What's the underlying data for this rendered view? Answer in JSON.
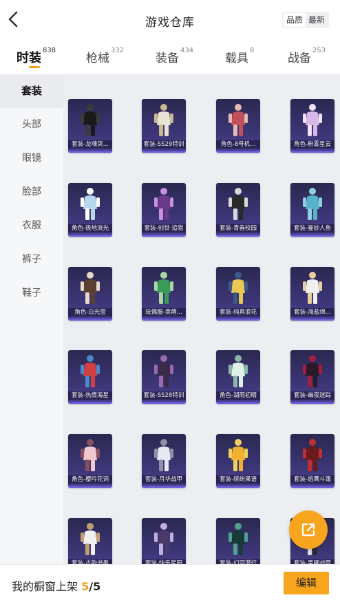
{
  "header": {
    "title": "游戏仓库",
    "sort_options": [
      "品质",
      "最新"
    ],
    "sort_selected": "品质"
  },
  "tabs": [
    {
      "label": "时装",
      "count": "838",
      "active": true
    },
    {
      "label": "枪械",
      "count": "332",
      "active": false
    },
    {
      "label": "装备",
      "count": "434",
      "active": false
    },
    {
      "label": "载具",
      "count": "8",
      "active": false
    },
    {
      "label": "战备",
      "count": "253",
      "active": false
    }
  ],
  "categories": [
    {
      "label": "套装",
      "active": true
    },
    {
      "label": "头部",
      "active": false
    },
    {
      "label": "眼镜",
      "active": false
    },
    {
      "label": "脸部",
      "active": false
    },
    {
      "label": "衣服",
      "active": false
    },
    {
      "label": "裤子",
      "active": false
    },
    {
      "label": "鞋子",
      "active": false
    }
  ],
  "items": [
    {
      "name": "套装-龙魂突..."
    },
    {
      "name": "套装-SS29特训"
    },
    {
      "name": "角色-8号机..."
    },
    {
      "name": "角色-粉雾星云"
    },
    {
      "name": "角色-极地流光"
    },
    {
      "name": "套装-创世·追猎"
    },
    {
      "name": "套装-青春校园"
    },
    {
      "name": "套装-曼妙人鱼"
    },
    {
      "name": "角色-白光莹"
    },
    {
      "name": "玩偶服-卖萌..."
    },
    {
      "name": "套装-纯真浪花"
    },
    {
      "name": "套装-海盐绵..."
    },
    {
      "name": "套装-热情海星"
    },
    {
      "name": "套装-SS28特训"
    },
    {
      "name": "角色-湖雨初晴"
    },
    {
      "name": "套装-幽夜迷踪"
    },
    {
      "name": "角色-樱吟花词"
    },
    {
      "name": "套装-月华战甲"
    },
    {
      "name": "套装-缤纷果语"
    },
    {
      "name": "套装-焰鹰斗篷"
    },
    {
      "name": "套装-古韵书墨"
    },
    {
      "name": "套装-快乐星园"
    },
    {
      "name": "套装-幻羽潜行"
    },
    {
      "name": "套装-黑曜战甲"
    }
  ],
  "showcase": {
    "label": "我的橱窗上架",
    "count": "5",
    "separator": "/",
    "total": "5"
  },
  "edit_label": "编辑",
  "icons": {
    "back": "chevron-left-icon",
    "share": "share-external-icon"
  },
  "colors": {
    "accent": "#f7a51c",
    "card_bg": "#3a3472"
  }
}
